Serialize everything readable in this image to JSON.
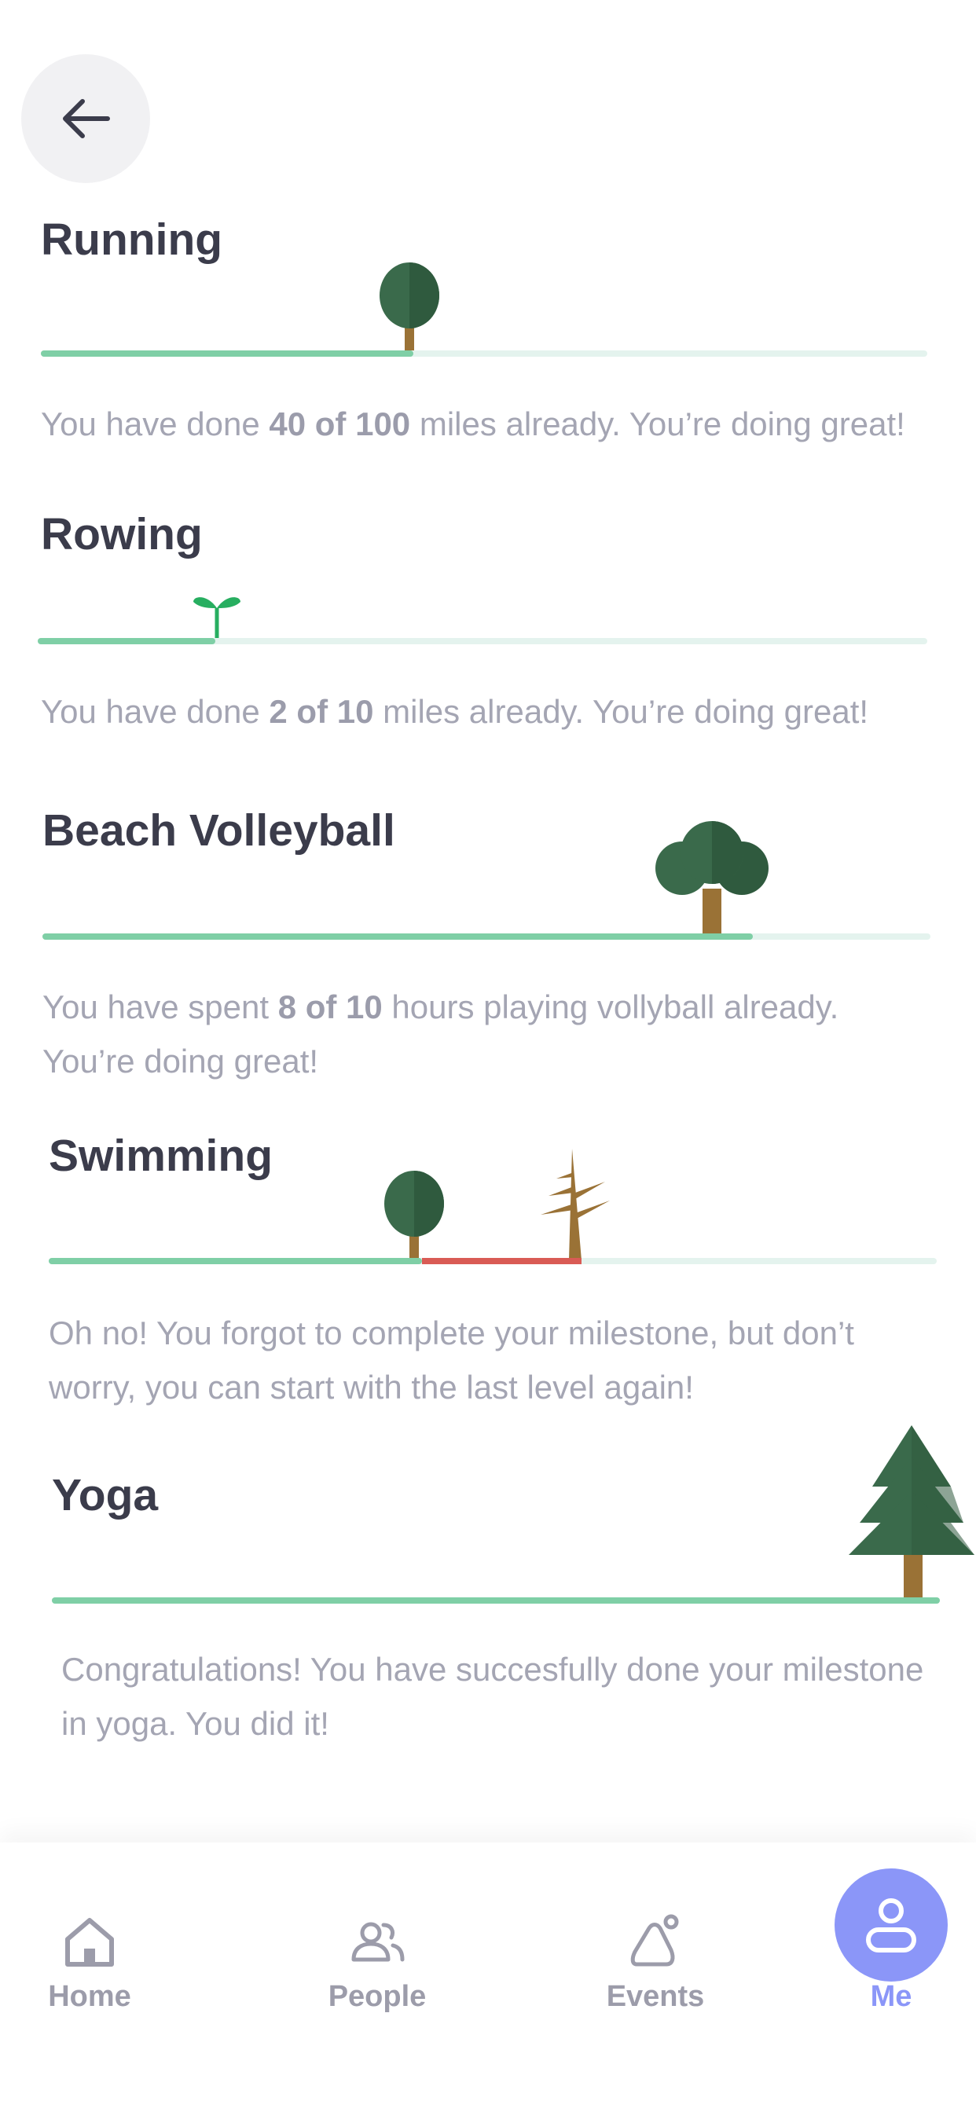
{
  "back_button": {
    "icon": "arrow-left-icon"
  },
  "milestones": [
    {
      "title": "Running",
      "progress": 0.42,
      "plant": "young-tree-icon",
      "desc_before": "You have done ",
      "desc_bold": "40 of 100",
      "desc_after": " miles already. You’re doing great!"
    },
    {
      "title": "Rowing",
      "progress": 0.2,
      "plant": "sprout-icon",
      "desc_before": "You have done ",
      "desc_bold": "2 of 10",
      "desc_after": " miles already. You’re doing great!"
    },
    {
      "title": "Beach Volleyball",
      "progress": 0.8,
      "plant": "bushy-tree-icon",
      "desc_before": "You have spent ",
      "desc_bold": "8 of 10",
      "desc_after": " hours playing vollyball already. You’re doing great!"
    },
    {
      "title": "Swimming",
      "progress": 0.42,
      "missed": 0.6,
      "plant": "young-tree-icon",
      "dead_plant": "dead-tree-icon",
      "desc": "Oh no! You forgot to complete your milestone, but don’t worry, you can start with the last level again!"
    },
    {
      "title": "Yoga",
      "progress": 1.0,
      "plant": "pine-tree-icon",
      "desc": "Congratulations! You have succesfully done your milestone in yoga. You did it!"
    }
  ],
  "tabs": [
    {
      "label": "Home",
      "icon": "home-icon",
      "active": false
    },
    {
      "label": "People",
      "icon": "people-icon",
      "active": false
    },
    {
      "label": "Events",
      "icon": "events-icon",
      "active": false
    },
    {
      "label": "Me",
      "icon": "profile-icon",
      "active": true
    }
  ],
  "colors": {
    "accent": "#8b96f8",
    "progress": "#7fcfa6",
    "track": "#e4f3ee",
    "missed": "#d95b55",
    "tree": "#3a6a4b",
    "trunk": "#9a7236"
  }
}
